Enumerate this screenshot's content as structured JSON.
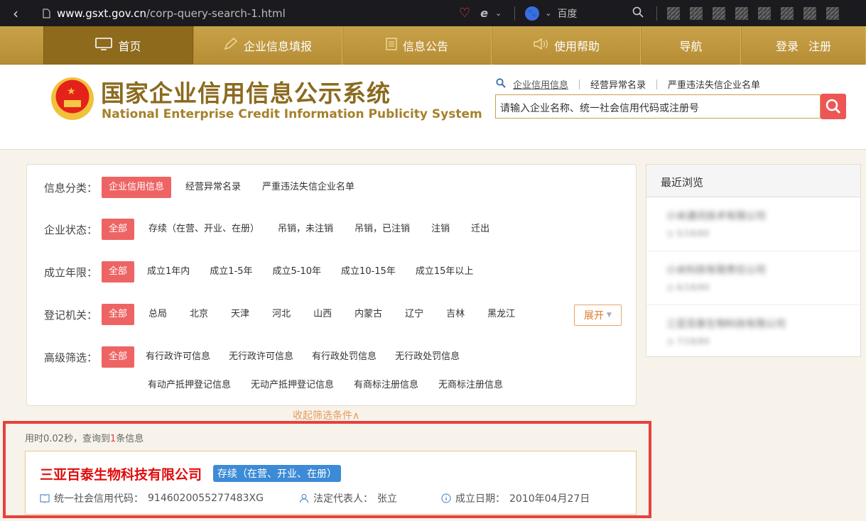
{
  "browser": {
    "url_domain": "www.gsxt.gov.cn",
    "url_path": "/corp-query-search-1.html",
    "search_engine": "百度"
  },
  "nav": {
    "home": "首页",
    "report": "企业信息填报",
    "notice": "信息公告",
    "help": "使用帮助",
    "guide": "导航",
    "login": "登录",
    "register": "注册"
  },
  "header": {
    "title_cn": "国家企业信用信息公示系统",
    "title_en": "National Enterprise Credit Information Publicity System",
    "categories": [
      "企业信用信息",
      "经营异常名录",
      "严重违法失信企业名单"
    ],
    "search_placeholder": "请输入企业名称、统一社会信用代码或注册号"
  },
  "filters": {
    "category": {
      "label": "信息分类：",
      "options": [
        "企业信用信息",
        "经营异常名录",
        "严重违法失信企业名单"
      ]
    },
    "status": {
      "label": "企业状态：",
      "options": [
        "全部",
        "存续（在营、开业、在册）",
        "吊销，未注销",
        "吊销，已注销",
        "注销",
        "迁出"
      ]
    },
    "years": {
      "label": "成立年限：",
      "options": [
        "全部",
        "成立1年内",
        "成立1-5年",
        "成立5-10年",
        "成立10-15年",
        "成立15年以上"
      ]
    },
    "authority": {
      "label": "登记机关：",
      "options": [
        "全部",
        "总局",
        "北京",
        "天津",
        "河北",
        "山西",
        "内蒙古",
        "辽宁",
        "吉林",
        "黑龙江"
      ]
    },
    "advanced": {
      "label": "高级筛选：",
      "options": [
        "全部",
        "有行政许可信息",
        "无行政许可信息",
        "有行政处罚信息",
        "无行政处罚信息",
        "有动产抵押登记信息",
        "无动产抵押登记信息",
        "有商标注册信息",
        "无商标注册信息"
      ]
    },
    "expand_label": "展开",
    "collapse_label": "收起筛选条件∧"
  },
  "recent": {
    "title": "最近浏览",
    "items": [
      {
        "name": "小米通讯技术有限公司",
        "date": "5/18/80"
      },
      {
        "name": "小米科技有限责任公司",
        "date": "6/18/80"
      },
      {
        "name": "三亚百泰生物科技有限公司",
        "date": "7/18/80"
      }
    ]
  },
  "results": {
    "meta_prefix": "用时0.02秒，查询到",
    "count": "1",
    "meta_suffix": "条信息",
    "company": {
      "name": "三亚百泰生物科技有限公司",
      "status": "存续（在营、开业、在册）",
      "credit_code_label": "统一社会信用代码：",
      "credit_code": "9146020055277483XG",
      "legal_rep_label": "法定代表人：",
      "legal_rep": "张立",
      "founded_label": "成立日期：",
      "founded": "2010年04月27日"
    }
  },
  "colors": {
    "nav_gold": "#c19a42",
    "nav_active": "#8d6a1c",
    "accent_red": "#ee6464",
    "status_blue": "#3d8bd7",
    "highlight_red": "#e8403d"
  }
}
